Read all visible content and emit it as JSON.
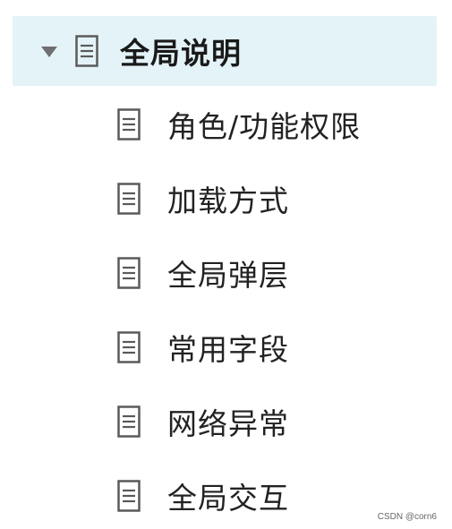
{
  "tree": {
    "parent": {
      "label": "全局说明",
      "icon": "document-icon",
      "expanded": true,
      "caret_icon": "caret-down-icon",
      "highlight_color": "#e4f3f7"
    },
    "children": [
      {
        "label": "角色/功能权限",
        "icon": "document-icon"
      },
      {
        "label": "加载方式",
        "icon": "document-icon"
      },
      {
        "label": "全局弹层",
        "icon": "document-icon"
      },
      {
        "label": "常用字段",
        "icon": "document-icon"
      },
      {
        "label": "网络异常",
        "icon": "document-icon"
      },
      {
        "label": "全局交互",
        "icon": "document-icon"
      }
    ]
  },
  "watermark": "CSDN @corn6"
}
